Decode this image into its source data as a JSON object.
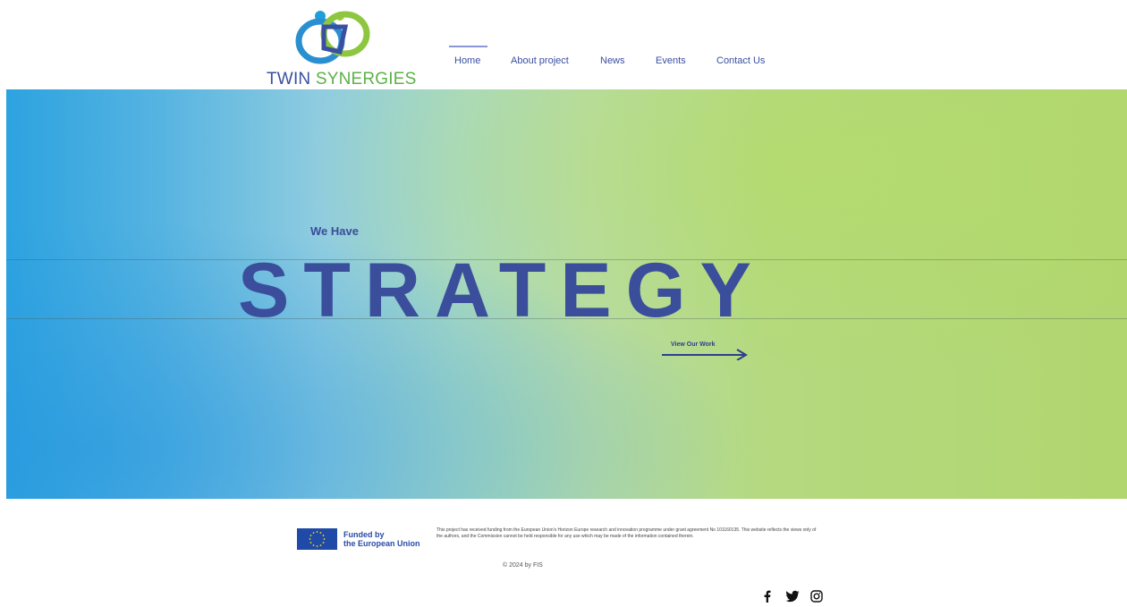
{
  "logo": {
    "word1": "TWIN",
    "word2": " SYNERGIES",
    "colors": {
      "blue": "#3a4fa0",
      "green": "#5cb247"
    }
  },
  "nav": {
    "items": [
      {
        "label": "Home",
        "active": true
      },
      {
        "label": "About project",
        "active": false
      },
      {
        "label": "News",
        "active": false
      },
      {
        "label": "Events",
        "active": false
      },
      {
        "label": "Contact Us",
        "active": false
      }
    ]
  },
  "hero": {
    "small_heading": "We Have",
    "big_heading": "STRATEGY",
    "cta_label": "View Our Work",
    "gradient_colors": [
      "#2ca3e0",
      "#a8d9c4",
      "#b1d66f"
    ],
    "text_color": "#3b4e9c"
  },
  "footer": {
    "funding_line1": "Funded by",
    "funding_line2": "the European Union",
    "disclaimer": "This project has received funding from the European Union's Horizon Europe research and innovation programme under grant agreement No 101160135. This website reflects the views only of the authors, and the Commission cannot be held responsible for any use which may be made of the information contained therein.",
    "copyright": "© 2024 by FIS",
    "social_icons": [
      "facebook-icon",
      "twitter-icon",
      "instagram-icon"
    ]
  }
}
